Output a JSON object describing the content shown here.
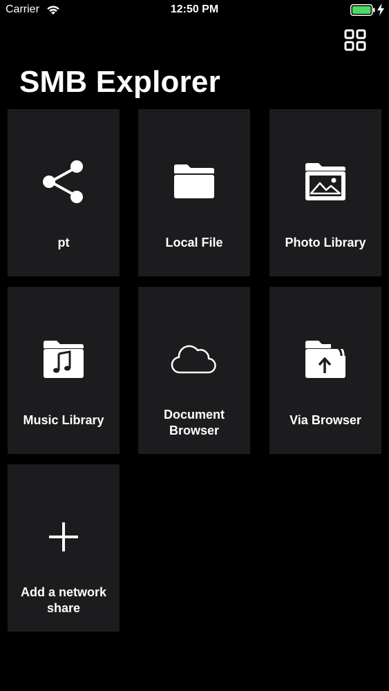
{
  "status_bar": {
    "carrier": "Carrier",
    "time": "12:50 PM",
    "battery_color": "#4cd964"
  },
  "header": {
    "title": "SMB Explorer",
    "view_toggle_icon": "grid-icon"
  },
  "tiles": [
    {
      "label": "pt",
      "icon": "share-icon"
    },
    {
      "label": "Local File",
      "icon": "folder-icon"
    },
    {
      "label": "Photo Library",
      "icon": "photo-folder-icon"
    },
    {
      "label": "Music Library",
      "icon": "music-folder-icon"
    },
    {
      "label": "Document Browser",
      "icon": "cloud-icon"
    },
    {
      "label": "Via Browser",
      "icon": "upload-folder-icon"
    },
    {
      "label": "Add a network share",
      "icon": "plus-icon"
    }
  ],
  "colors": {
    "background": "#000000",
    "tile": "#1c1c1e",
    "text": "#ffffff"
  }
}
